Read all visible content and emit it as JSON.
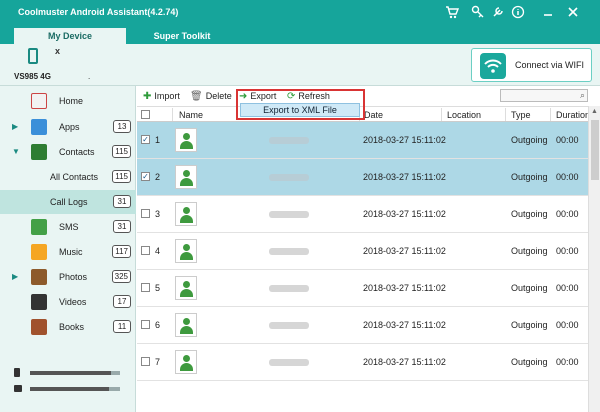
{
  "app": {
    "title": "Coolmuster Android Assistant(4.2.74)"
  },
  "header_icons": [
    "cart-icon",
    "key-icon",
    "wrench-icon",
    "info-icon",
    "minimize-icon",
    "close-icon"
  ],
  "tabs": {
    "my_device": "My Device",
    "super_toolkit": "Super Toolkit"
  },
  "device": {
    "name": "VS985 4G",
    "close": "x",
    "dot": "."
  },
  "wifi": {
    "label": "Connect via WIFI"
  },
  "sidebar": {
    "items": [
      {
        "label": "Home",
        "count": ""
      },
      {
        "label": "Apps",
        "count": "13"
      },
      {
        "label": "Contacts",
        "count": "115"
      },
      {
        "label": "All Contacts",
        "count": "115"
      },
      {
        "label": "Call Logs",
        "count": "31"
      },
      {
        "label": "SMS",
        "count": "31"
      },
      {
        "label": "Music",
        "count": "117"
      },
      {
        "label": "Photos",
        "count": "325"
      },
      {
        "label": "Videos",
        "count": "17"
      },
      {
        "label": "Books",
        "count": "11"
      }
    ],
    "storage": [
      {
        "fill": 0.9
      },
      {
        "fill": 0.88
      }
    ]
  },
  "toolbar": {
    "import": "Import",
    "delete": "Delete",
    "export": "Export",
    "refresh": "Refresh",
    "export_menu_item": "Export to XML File",
    "search_placeholder": ""
  },
  "table": {
    "columns": [
      "Name",
      "Date",
      "Location",
      "Type",
      "Duration"
    ],
    "rows": [
      {
        "num": "1",
        "date": "2018-03-27 15:11:02",
        "location": "",
        "type": "Outgoing",
        "duration": "00:00",
        "checked": true
      },
      {
        "num": "2",
        "date": "2018-03-27 15:11:02",
        "location": "",
        "type": "Outgoing",
        "duration": "00:00",
        "checked": true
      },
      {
        "num": "3",
        "date": "2018-03-27 15:11:02",
        "location": "",
        "type": "Outgoing",
        "duration": "00:00",
        "checked": false
      },
      {
        "num": "4",
        "date": "2018-03-27 15:11:02",
        "location": "",
        "type": "Outgoing",
        "duration": "00:00",
        "checked": false
      },
      {
        "num": "5",
        "date": "2018-03-27 15:11:02",
        "location": "",
        "type": "Outgoing",
        "duration": "00:00",
        "checked": false
      },
      {
        "num": "6",
        "date": "2018-03-27 15:11:02",
        "location": "",
        "type": "Outgoing",
        "duration": "00:00",
        "checked": false
      },
      {
        "num": "7",
        "date": "2018-03-27 15:11:02",
        "location": "",
        "type": "Outgoing",
        "duration": "00:00",
        "checked": false
      }
    ]
  },
  "colors": {
    "accent": "#16a59b",
    "selected_row": "#add8e6",
    "highlight_box": "#d93434"
  }
}
